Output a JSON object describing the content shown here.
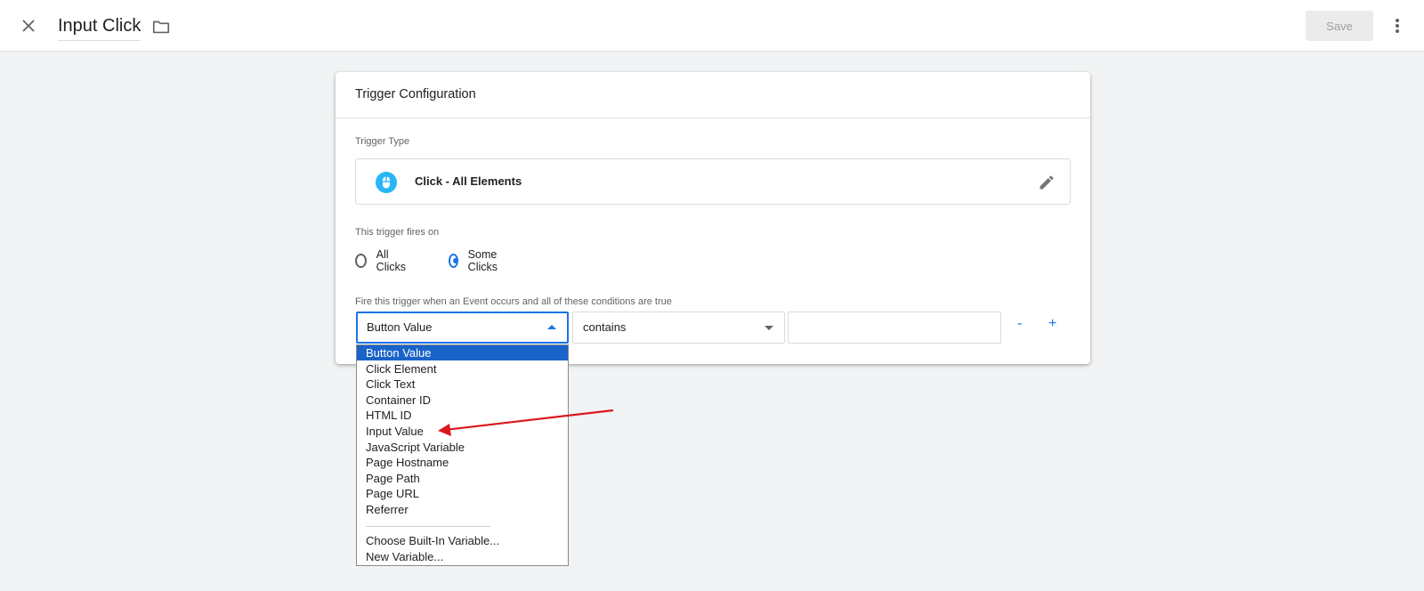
{
  "header": {
    "title": "Input Click",
    "save_label": "Save"
  },
  "card": {
    "title": "Trigger Configuration",
    "trigger_type_label": "Trigger Type",
    "trigger_type_name": "Click - All Elements",
    "fires_on_label": "This trigger fires on",
    "radio_options": [
      {
        "label": "All Clicks",
        "checked": false
      },
      {
        "label": "Some Clicks",
        "checked": true
      }
    ],
    "condition_label": "Fire this trigger when an Event occurs and all of these conditions are true",
    "variable_select_value": "Button Value",
    "operator_select_value": "contains",
    "value_input": "",
    "remove_label": "-",
    "add_label": "+"
  },
  "dropdown": {
    "items": [
      "Button Value",
      "Click Element",
      "Click Text",
      "Container ID",
      "HTML ID",
      "Input Value",
      "JavaScript Variable",
      "Page Hostname",
      "Page Path",
      "Page URL",
      "Referrer"
    ],
    "selected_index": 0,
    "extra_items": [
      "Choose Built-In Variable...",
      "New Variable..."
    ]
  },
  "colors": {
    "accent": "#1a73e8",
    "selected_item_bg": "#1a63c8",
    "annotation_arrow": "#d9191f",
    "mouse_icon": "#29b6f6"
  }
}
